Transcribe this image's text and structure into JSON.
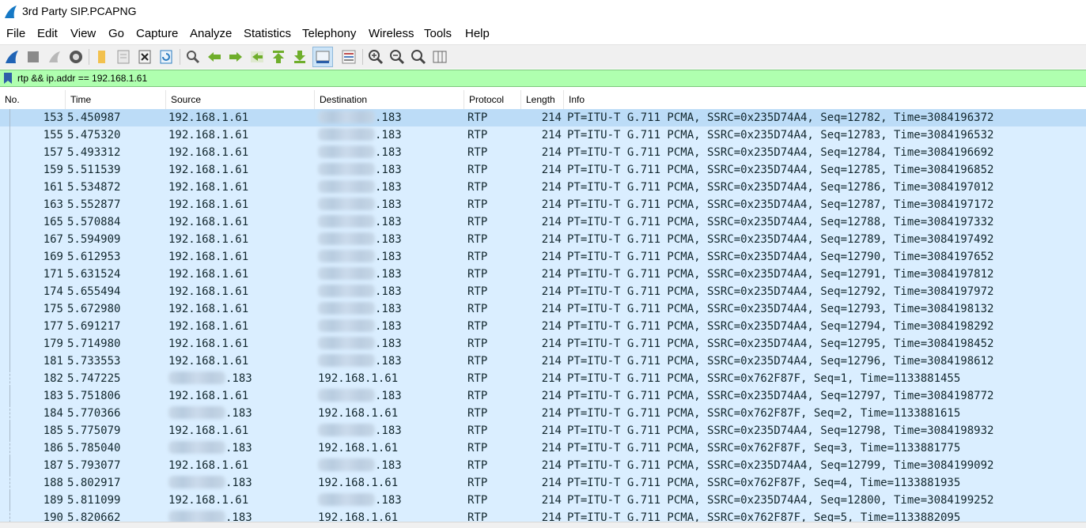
{
  "window": {
    "title": "3rd Party SIP.PCAPNG"
  },
  "menu": [
    "File",
    "Edit",
    "View",
    "Go",
    "Capture",
    "Analyze",
    "Statistics",
    "Telephony",
    "Wireless",
    "Tools",
    "Help"
  ],
  "toolbar": [
    "shark-fin-start-icon",
    "stop-capture-icon",
    "restart-capture-icon",
    "capture-options-icon",
    "open-file-icon",
    "save-file-icon",
    "close-file-icon",
    "reload-file-icon",
    "find-packet-icon",
    "go-back-icon",
    "go-forward-icon",
    "go-to-packet-icon",
    "go-first-packet-icon",
    "go-last-packet-icon",
    "autoscroll-icon",
    "colorize-icon",
    "zoom-in-icon",
    "zoom-out-icon",
    "zoom-normal-icon",
    "resize-columns-icon"
  ],
  "filter": {
    "text": "rtp && ip.addr == 192.168.1.61",
    "bg": "#afffaf"
  },
  "columns": [
    "No.",
    "Time",
    "Source",
    "Destination",
    "Protocol",
    "Length",
    "Info"
  ],
  "colors": {
    "row_bg": "#daeeff",
    "row_selected": "#bcdcf7",
    "row_text": "#12272e"
  },
  "rows": [
    {
      "no": "153",
      "time": "5.450987",
      "src": "192.168.1.61",
      "src_blur": false,
      "dst": ".183",
      "dst_blur": true,
      "proto": "RTP",
      "len": "214",
      "info": "PT=ITU-T G.711 PCMA, SSRC=0x235D74A4, Seq=12782, Time=3084196372",
      "selected": true
    },
    {
      "no": "155",
      "time": "5.475320",
      "src": "192.168.1.61",
      "src_blur": false,
      "dst": ".183",
      "dst_blur": true,
      "proto": "RTP",
      "len": "214",
      "info": "PT=ITU-T G.711 PCMA, SSRC=0x235D74A4, Seq=12783, Time=3084196532"
    },
    {
      "no": "157",
      "time": "5.493312",
      "src": "192.168.1.61",
      "src_blur": false,
      "dst": ".183",
      "dst_blur": true,
      "proto": "RTP",
      "len": "214",
      "info": "PT=ITU-T G.711 PCMA, SSRC=0x235D74A4, Seq=12784, Time=3084196692"
    },
    {
      "no": "159",
      "time": "5.511539",
      "src": "192.168.1.61",
      "src_blur": false,
      "dst": ".183",
      "dst_blur": true,
      "proto": "RTP",
      "len": "214",
      "info": "PT=ITU-T G.711 PCMA, SSRC=0x235D74A4, Seq=12785, Time=3084196852"
    },
    {
      "no": "161",
      "time": "5.534872",
      "src": "192.168.1.61",
      "src_blur": false,
      "dst": ".183",
      "dst_blur": true,
      "proto": "RTP",
      "len": "214",
      "info": "PT=ITU-T G.711 PCMA, SSRC=0x235D74A4, Seq=12786, Time=3084197012"
    },
    {
      "no": "163",
      "time": "5.552877",
      "src": "192.168.1.61",
      "src_blur": false,
      "dst": ".183",
      "dst_blur": true,
      "proto": "RTP",
      "len": "214",
      "info": "PT=ITU-T G.711 PCMA, SSRC=0x235D74A4, Seq=12787, Time=3084197172"
    },
    {
      "no": "165",
      "time": "5.570884",
      "src": "192.168.1.61",
      "src_blur": false,
      "dst": ".183",
      "dst_blur": true,
      "proto": "RTP",
      "len": "214",
      "info": "PT=ITU-T G.711 PCMA, SSRC=0x235D74A4, Seq=12788, Time=3084197332"
    },
    {
      "no": "167",
      "time": "5.594909",
      "src": "192.168.1.61",
      "src_blur": false,
      "dst": ".183",
      "dst_blur": true,
      "proto": "RTP",
      "len": "214",
      "info": "PT=ITU-T G.711 PCMA, SSRC=0x235D74A4, Seq=12789, Time=3084197492"
    },
    {
      "no": "169",
      "time": "5.612953",
      "src": "192.168.1.61",
      "src_blur": false,
      "dst": ".183",
      "dst_blur": true,
      "proto": "RTP",
      "len": "214",
      "info": "PT=ITU-T G.711 PCMA, SSRC=0x235D74A4, Seq=12790, Time=3084197652"
    },
    {
      "no": "171",
      "time": "5.631524",
      "src": "192.168.1.61",
      "src_blur": false,
      "dst": ".183",
      "dst_blur": true,
      "proto": "RTP",
      "len": "214",
      "info": "PT=ITU-T G.711 PCMA, SSRC=0x235D74A4, Seq=12791, Time=3084197812"
    },
    {
      "no": "174",
      "time": "5.655494",
      "src": "192.168.1.61",
      "src_blur": false,
      "dst": ".183",
      "dst_blur": true,
      "proto": "RTP",
      "len": "214",
      "info": "PT=ITU-T G.711 PCMA, SSRC=0x235D74A4, Seq=12792, Time=3084197972"
    },
    {
      "no": "175",
      "time": "5.672980",
      "src": "192.168.1.61",
      "src_blur": false,
      "dst": ".183",
      "dst_blur": true,
      "proto": "RTP",
      "len": "214",
      "info": "PT=ITU-T G.711 PCMA, SSRC=0x235D74A4, Seq=12793, Time=3084198132"
    },
    {
      "no": "177",
      "time": "5.691217",
      "src": "192.168.1.61",
      "src_blur": false,
      "dst": ".183",
      "dst_blur": true,
      "proto": "RTP",
      "len": "214",
      "info": "PT=ITU-T G.711 PCMA, SSRC=0x235D74A4, Seq=12794, Time=3084198292"
    },
    {
      "no": "179",
      "time": "5.714980",
      "src": "192.168.1.61",
      "src_blur": false,
      "dst": ".183",
      "dst_blur": true,
      "proto": "RTP",
      "len": "214",
      "info": "PT=ITU-T G.711 PCMA, SSRC=0x235D74A4, Seq=12795, Time=3084198452"
    },
    {
      "no": "181",
      "time": "5.733553",
      "src": "192.168.1.61",
      "src_blur": false,
      "dst": ".183",
      "dst_blur": true,
      "proto": "RTP",
      "len": "214",
      "info": "PT=ITU-T G.711 PCMA, SSRC=0x235D74A4, Seq=12796, Time=3084198612"
    },
    {
      "no": "182",
      "time": "5.747225",
      "src": ".183",
      "src_blur": true,
      "dst": "192.168.1.61",
      "dst_blur": false,
      "proto": "RTP",
      "len": "214",
      "info": "PT=ITU-T G.711 PCMA, SSRC=0x762F87F, Seq=1, Time=1133881455"
    },
    {
      "no": "183",
      "time": "5.751806",
      "src": "192.168.1.61",
      "src_blur": false,
      "dst": ".183",
      "dst_blur": true,
      "proto": "RTP",
      "len": "214",
      "info": "PT=ITU-T G.711 PCMA, SSRC=0x235D74A4, Seq=12797, Time=3084198772"
    },
    {
      "no": "184",
      "time": "5.770366",
      "src": ".183",
      "src_blur": true,
      "dst": "192.168.1.61",
      "dst_blur": false,
      "proto": "RTP",
      "len": "214",
      "info": "PT=ITU-T G.711 PCMA, SSRC=0x762F87F, Seq=2, Time=1133881615"
    },
    {
      "no": "185",
      "time": "5.775079",
      "src": "192.168.1.61",
      "src_blur": false,
      "dst": ".183",
      "dst_blur": true,
      "proto": "RTP",
      "len": "214",
      "info": "PT=ITU-T G.711 PCMA, SSRC=0x235D74A4, Seq=12798, Time=3084198932"
    },
    {
      "no": "186",
      "time": "5.785040",
      "src": ".183",
      "src_blur": true,
      "dst": "192.168.1.61",
      "dst_blur": false,
      "proto": "RTP",
      "len": "214",
      "info": "PT=ITU-T G.711 PCMA, SSRC=0x762F87F, Seq=3, Time=1133881775"
    },
    {
      "no": "187",
      "time": "5.793077",
      "src": "192.168.1.61",
      "src_blur": false,
      "dst": ".183",
      "dst_blur": true,
      "proto": "RTP",
      "len": "214",
      "info": "PT=ITU-T G.711 PCMA, SSRC=0x235D74A4, Seq=12799, Time=3084199092"
    },
    {
      "no": "188",
      "time": "5.802917",
      "src": ".183",
      "src_blur": true,
      "dst": "192.168.1.61",
      "dst_blur": false,
      "proto": "RTP",
      "len": "214",
      "info": "PT=ITU-T G.711 PCMA, SSRC=0x762F87F, Seq=4, Time=1133881935"
    },
    {
      "no": "189",
      "time": "5.811099",
      "src": "192.168.1.61",
      "src_blur": false,
      "dst": ".183",
      "dst_blur": true,
      "proto": "RTP",
      "len": "214",
      "info": "PT=ITU-T G.711 PCMA, SSRC=0x235D74A4, Seq=12800, Time=3084199252"
    },
    {
      "no": "190",
      "time": "5.820662",
      "src": ".183",
      "src_blur": true,
      "dst": "192.168.1.61",
      "dst_blur": false,
      "proto": "RTP",
      "len": "214",
      "info": "PT=ITU-T G.711 PCMA, SSRC=0x762F87F, Seq=5, Time=1133882095"
    }
  ]
}
